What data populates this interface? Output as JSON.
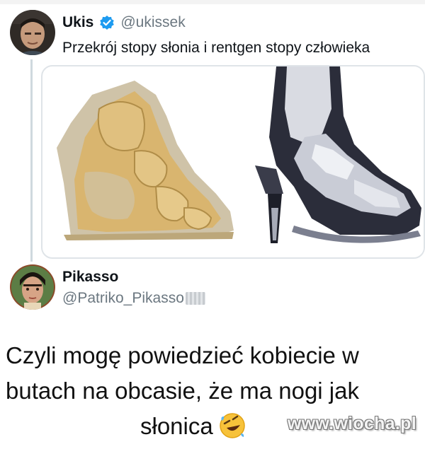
{
  "tweet": {
    "author_name": "Ukis",
    "author_handle": "@ukissek",
    "text": "Przekrój stopy słonia i rentgen stopy człowieka",
    "verified_icon": "verified-badge-icon",
    "media": [
      "elephant-foot-cross-section",
      "human-foot-xray-in-high-heel"
    ]
  },
  "reply": {
    "author_name": "Pikasso",
    "author_handle": "@Patriko_Pikasso"
  },
  "caption": {
    "line1": "Czyli mogę powiedzieć kobiecie w",
    "line2": "butach na obcasie, że ma nogi jak",
    "line3": "słonica",
    "emoji_icon": "rolling-on-floor-laughing-emoji-icon"
  },
  "watermark": "www.wiocha.pl",
  "colors": {
    "verified_blue": "#1d9bf0",
    "handle_gray": "#6b7780",
    "thread_line": "#cfd9de"
  }
}
